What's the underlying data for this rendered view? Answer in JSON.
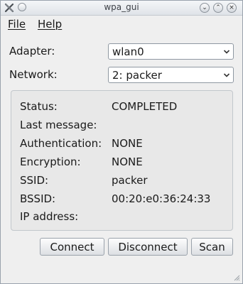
{
  "window": {
    "title": "wpa_gui"
  },
  "menubar": {
    "file": "File",
    "help": "Help"
  },
  "adapter": {
    "label": "Adapter:",
    "value": "wlan0"
  },
  "network": {
    "label": "Network:",
    "value": "2: packer"
  },
  "status_rows": [
    {
      "label": "Status:",
      "value": "COMPLETED"
    },
    {
      "label": "Last message:",
      "value": ""
    },
    {
      "label": "Authentication:",
      "value": "NONE"
    },
    {
      "label": "Encryption:",
      "value": "NONE"
    },
    {
      "label": "SSID:",
      "value": "packer"
    },
    {
      "label": "BSSID:",
      "value": "00:20:e0:36:24:33"
    },
    {
      "label": "IP address:",
      "value": ""
    }
  ],
  "buttons": {
    "connect": "Connect",
    "disconnect": "Disconnect",
    "scan": "Scan"
  },
  "icons": {
    "app": "app-icon",
    "pin": "pin-icon",
    "minimize": "minimize-icon",
    "maximize": "maximize-icon",
    "close": "close-icon",
    "dropdown": "chevron-down-icon",
    "grip": "resize-grip-icon"
  }
}
